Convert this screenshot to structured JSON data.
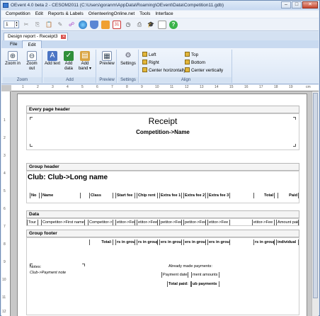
{
  "window": {
    "title": "OEvent 4.0 beta 2 - CESOM2011 (C:\\Users\\goranm\\AppData\\Roaming\\OEvent\\Data\\Competition11.gdb)",
    "min": "–",
    "max": "□",
    "close": "✕"
  },
  "menu": [
    "Competition",
    "Edit",
    "Reports & Labels",
    "OrienteeringOnline.net",
    "Tools",
    "Interface"
  ],
  "toolbar": {
    "spin_value": "1",
    "icons": [
      "scissors-icon",
      "copy-icon",
      "paste-icon",
      "edit-icon",
      "network-icon",
      "globe-icon",
      "shield-icon",
      "chart-icon",
      "calendar-icon",
      "clock-icon",
      "printer-icon",
      "mortarboard-icon",
      "document-icon",
      "help-icon"
    ],
    "calendar_day": "31"
  },
  "doc_tab": {
    "label": "Design report - Receipt3"
  },
  "ribbon_tabs": [
    "File",
    "Edit"
  ],
  "ribbon": {
    "zoom": {
      "label": "Zoom",
      "zoom_in": "Zoom in",
      "zoom_out": "Zoom out"
    },
    "add": {
      "label": "Add",
      "add_text": "Add text",
      "add_data": "Add data",
      "add_band": "Add band"
    },
    "preview": {
      "label": "Preview",
      "preview": "Preview"
    },
    "settings": {
      "label": "Settings",
      "settings": "Settings"
    },
    "align": {
      "label": "Align",
      "left": "Left",
      "right": "Right",
      "center_h": "Center horizontally",
      "top": "Top",
      "bottom": "Bottom",
      "center_v": "Center vertically"
    }
  },
  "ruler": {
    "unit": "cm",
    "numbers": [
      "1",
      "2",
      "3",
      "4",
      "5",
      "6",
      "7",
      "8",
      "9",
      "10",
      "11",
      "12",
      "13",
      "14",
      "15",
      "16",
      "17",
      "18",
      "19"
    ]
  },
  "vruler_numbers": [
    "1",
    "2",
    "3",
    "4",
    "5",
    "6",
    "7",
    "8",
    "9",
    "10",
    "11",
    "12"
  ],
  "report": {
    "every_page_header": "Every page header",
    "receipt_title": "Receipt",
    "competition_name": "Competition->Name",
    "group_header": "Group header",
    "club_name": "Club: Club->Long name",
    "columns": [
      "No",
      "Name",
      "Class",
      "Start fee",
      "Chip rent",
      "Extra fee 1",
      "Extra fee 2",
      "Extra fee 3",
      "Total",
      "Paid"
    ],
    "data_band": "Data",
    "data_fields": [
      "Tour",
      "Competitor->First name +",
      "Competitor->",
      "etitor->Fee",
      "etitor->Fee",
      "petitor->Fee",
      "petitor->Fee",
      "etitor->Fee",
      "etitor->Fee",
      "Amount paid"
    ],
    "group_footer": "Group footer",
    "footer_totals": [
      "Total:",
      "rs in group",
      "rs in group",
      "ers in group",
      "ers in group",
      "ers in group",
      "rs in group",
      "individual"
    ],
    "notes_label": "Notes:",
    "notes_field": "Club->Payment note",
    "ready_payments": "Already made payments:",
    "payment_dates": "Payment dates",
    "payment_amounts": "ment amounts",
    "total_paid": "Total paid:",
    "club_payments": "ub payments"
  }
}
